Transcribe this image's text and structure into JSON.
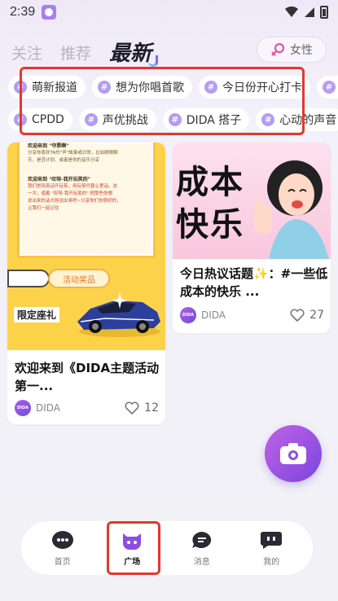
{
  "status": {
    "time": "2:39"
  },
  "tabs": [
    {
      "label": "关注"
    },
    {
      "label": "推荐"
    },
    {
      "label": "最新"
    }
  ],
  "gender_filter": {
    "label": "女性"
  },
  "topics": {
    "row1": [
      "萌新报道",
      "想为你唱首歌",
      "今日份开心打卡",
      "心"
    ],
    "row2": [
      "CPDD",
      "声优挑战",
      "DIDA 搭子",
      "心动的声音"
    ]
  },
  "cards": [
    {
      "thumb_lines": [
        "欢迎来到 \"夺票啊\"",
        "分享你喜欢TA的\"声\"故事或日常，比如眼睛聊",
        "天、是否计划、或者是你的音乐分享",
        "欢迎来到 \"叹呀-我开玩笑的\"",
        "我们常用真话开玩笑，用玩笑代替心里话。这",
        "一次，借着 \"叹呀-我开玩笑的\" 把那些你想",
        "说出来的话大胆说出来吧~分享你们你那好的，",
        "让我们一起记住"
      ],
      "activity_tag": "活动奖品",
      "limited_label": "限定座礼",
      "title": "欢迎来到《DIDA主题活动第一...",
      "author": "DIDA",
      "likes": "12"
    },
    {
      "thumb_text_1": "成本",
      "thumb_text_2": "快乐",
      "title": "今日热议话题✨：#一些低成本的快乐 ...",
      "author": "DIDA",
      "likes": "27"
    }
  ],
  "bottom_nav": [
    {
      "label": "首页"
    },
    {
      "label": "广场"
    },
    {
      "label": "消息"
    },
    {
      "label": "我的"
    }
  ],
  "colors": {
    "accent_purple": "#7b45de",
    "highlight_red": "#e03a2a",
    "chip_hash": "#b49cf3"
  }
}
